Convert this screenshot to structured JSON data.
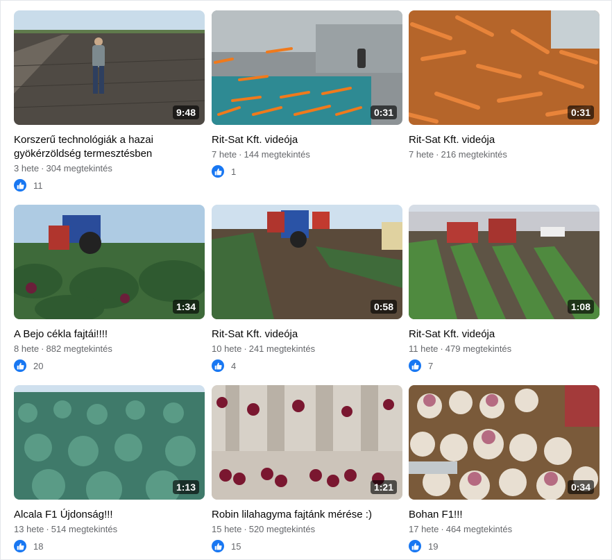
{
  "videos": [
    {
      "title": "Korszerű technológiák a hazai gyökérzöldség termesztésben",
      "duration": "9:48",
      "age": "3 hete",
      "views": "304 megtekintés",
      "likes": "11",
      "thumb": "field-man"
    },
    {
      "title": "Rit-Sat Kft. videója",
      "duration": "0:31",
      "age": "7 hete",
      "views": "144 megtekintés",
      "likes": "1",
      "thumb": "carrot-conveyor"
    },
    {
      "title": "Rit-Sat Kft. videója",
      "duration": "0:31",
      "age": "7 hete",
      "views": "216 megtekintés",
      "likes": "",
      "thumb": "carrot-pile"
    },
    {
      "title": "A Bejo cékla fajtái!!!!",
      "duration": "1:34",
      "age": "8 hete",
      "views": "882 megtekintés",
      "likes": "20",
      "thumb": "tractor-beet"
    },
    {
      "title": "Rit-Sat Kft. videója",
      "duration": "0:58",
      "age": "10 hete",
      "views": "241 megtekintés",
      "likes": "4",
      "thumb": "harvester-rows"
    },
    {
      "title": "Rit-Sat Kft. videója",
      "duration": "1:08",
      "age": "11 hete",
      "views": "479 megtekintés",
      "likes": "7",
      "thumb": "tractors-field"
    },
    {
      "title": "Alcala F1 Újdonság!!!",
      "duration": "1:13",
      "age": "13 hete",
      "views": "514 megtekintés",
      "likes": "18",
      "thumb": "cabbage-field"
    },
    {
      "title": "Robin lilahagyma fajtánk mérése :)",
      "duration": "1:21",
      "age": "15 hete",
      "views": "520 megtekintés",
      "likes": "15",
      "thumb": "onion-machine"
    },
    {
      "title": "Bohan F1!!!",
      "duration": "0:34",
      "age": "17 hete",
      "views": "464 megtekintés",
      "likes": "19",
      "thumb": "turnip-pile"
    }
  ],
  "dot": "·",
  "colors": {
    "like": "#1877f2",
    "meta": "#65676b"
  }
}
